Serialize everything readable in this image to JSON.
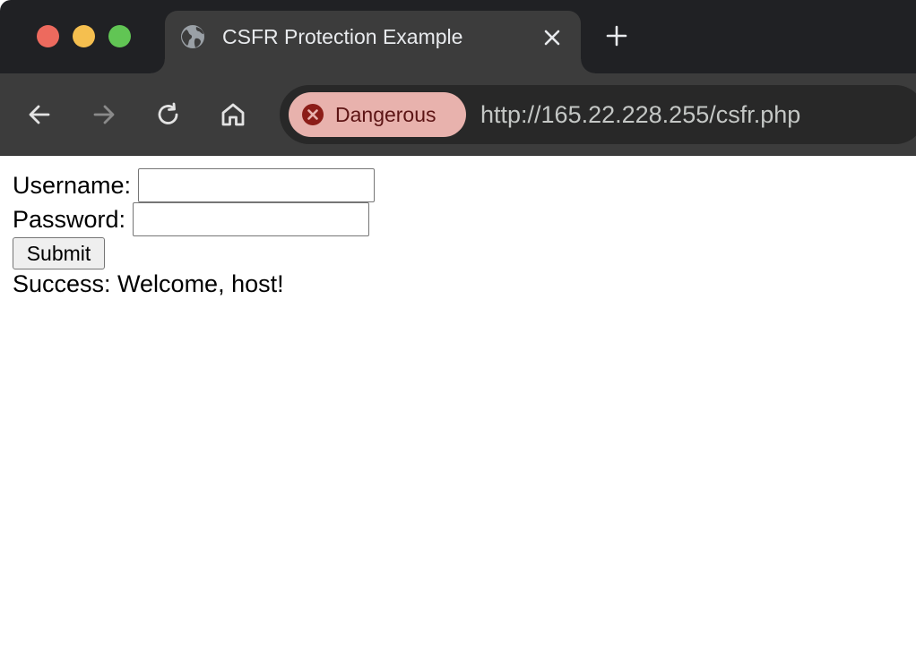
{
  "browser": {
    "tab": {
      "title": "CSFR Protection Example",
      "favicon_icon": "globe-icon",
      "close_icon": "close-icon"
    },
    "new_tab_icon": "plus-icon",
    "nav": {
      "back_icon": "arrow-left-icon",
      "forward_icon": "arrow-right-icon",
      "reload_icon": "reload-icon",
      "home_icon": "home-icon"
    },
    "security": {
      "label": "Dangerous",
      "icon": "error-circle-icon",
      "color": "#e8b2ad"
    },
    "url": "http://165.22.228.255/csfr.php"
  },
  "form": {
    "username_label": "Username:",
    "username_value": "",
    "password_label": "Password:",
    "password_value": "",
    "submit_label": "Submit"
  },
  "message": "Success: Welcome, host!"
}
